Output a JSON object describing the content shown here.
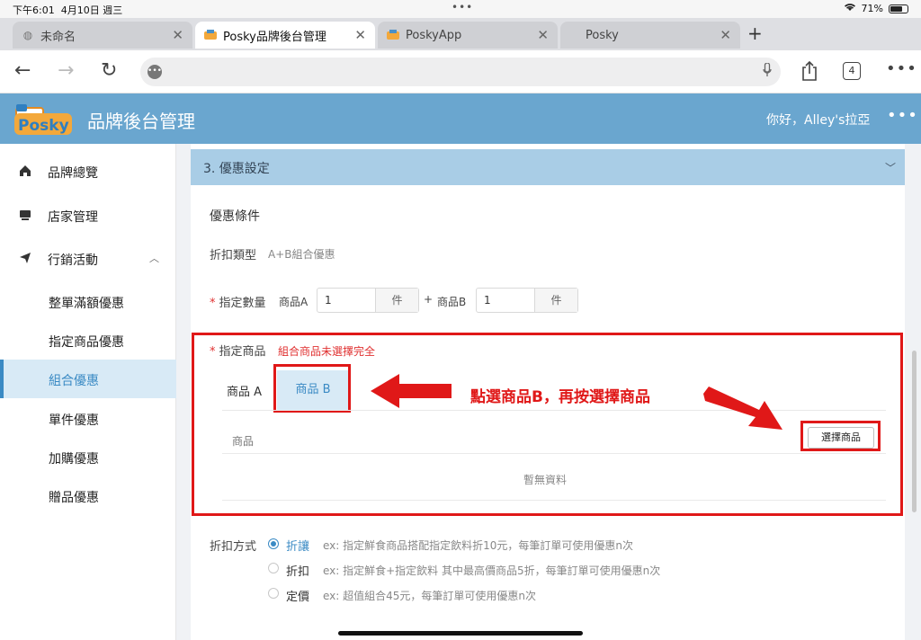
{
  "status": {
    "time": "下午6:01",
    "date": "4月10日 週三",
    "battery": "71%",
    "battery_level": 0.71
  },
  "tabs": [
    {
      "title": "未命名",
      "active": false
    },
    {
      "title": "Posky品牌後台管理",
      "active": true
    },
    {
      "title": "PoskyApp",
      "active": false
    },
    {
      "title": "Posky",
      "active": false
    }
  ],
  "browser": {
    "tab_count": "4"
  },
  "app": {
    "logo_text": "Posky",
    "title": "品牌後台管理",
    "greeting": "你好，Alley's拉亞"
  },
  "sidebar": {
    "items": [
      {
        "label": "品牌總覽",
        "icon": "home-icon"
      },
      {
        "label": "店家管理",
        "icon": "store-icon"
      },
      {
        "label": "行銷活動",
        "icon": "send-icon",
        "expanded": true
      }
    ],
    "sub_items": [
      "整單滿額優惠",
      "指定商品優惠",
      "組合優惠",
      "單件優惠",
      "加購優惠",
      "贈品優惠"
    ],
    "active_sub": "組合優惠"
  },
  "section": {
    "title": "3. 優惠設定"
  },
  "form": {
    "condition_title": "優惠條件",
    "discount_type_label": "折扣類型",
    "discount_type_value": "A+B組合優惠",
    "qty_label": "指定數量",
    "item_a_label": "商品A",
    "item_a_qty": "1",
    "item_b_label": "商品B",
    "item_b_qty": "1",
    "unit": "件",
    "plus": "+",
    "required_mark": "*",
    "products_label": "指定商品",
    "products_error": "組合商品未選擇完全",
    "product_tab_a": "商品 A",
    "product_tab_b": "商品 B",
    "table_header": "商品",
    "select_button": "選擇商品",
    "empty_text": "暫無資料",
    "annotation": "點選商品B，再按選擇商品",
    "method_label": "折扣方式",
    "methods": [
      {
        "label": "折讓",
        "desc": "ex: 指定鮮食商品搭配指定飲料折10元，每筆訂單可使用優惠n次",
        "selected": true
      },
      {
        "label": "折扣",
        "desc": "ex: 指定鮮食+指定飲料 其中最高價商品5折，每筆訂單可使用優惠n次",
        "selected": false
      },
      {
        "label": "定價",
        "desc": "ex: 超值組合45元，每筆訂單可使用優惠n次",
        "selected": false
      }
    ]
  },
  "colors": {
    "header": "#6aa6cf",
    "accent": "#3a8ac4",
    "annotation": "#e01818"
  }
}
